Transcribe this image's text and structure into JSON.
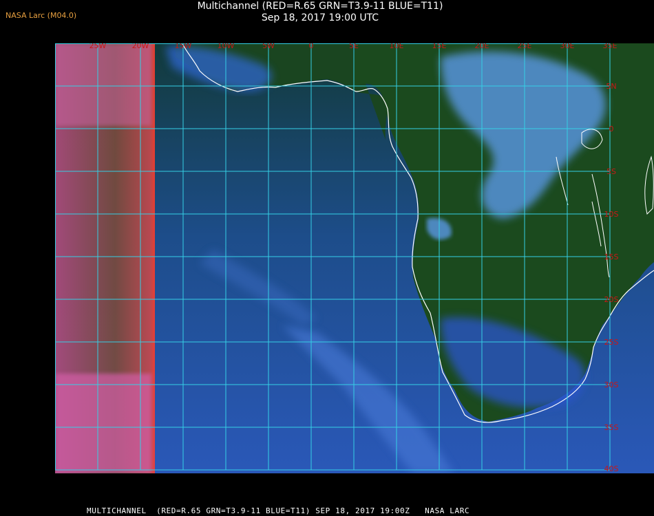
{
  "header": {
    "source_label": "NASA Larc (M04.0)",
    "title": "Multichannel (RED=R.65 GRN=T3.9-11 BLUE=T11)",
    "subtitle": "Sep 18, 2017 19:00 UTC"
  },
  "footer": {
    "caption": "MULTICHANNEL  (RED=R.65 GRN=T3.9-11 BLUE=T11) SEP 18, 2017 19:00Z   NASA LARC"
  },
  "map": {
    "longitude_labels": [
      "25W",
      "20W",
      "15W",
      "10W",
      "5W",
      "0",
      "5E",
      "10E",
      "15E",
      "20E",
      "25E",
      "30E",
      "35E"
    ],
    "latitude_labels": [
      "5N",
      "0",
      "5S",
      "10S",
      "15S",
      "20S",
      "25S",
      "30S",
      "35S",
      "40S"
    ],
    "colors": {
      "ocean": "#1f4fa0",
      "land": "#1c4a1e",
      "clouds": "#5fa2ea",
      "sunlit_edge": "#c4508a",
      "grid": "#35d0e6",
      "coast": "#ffffff",
      "label": "#c81818"
    }
  }
}
